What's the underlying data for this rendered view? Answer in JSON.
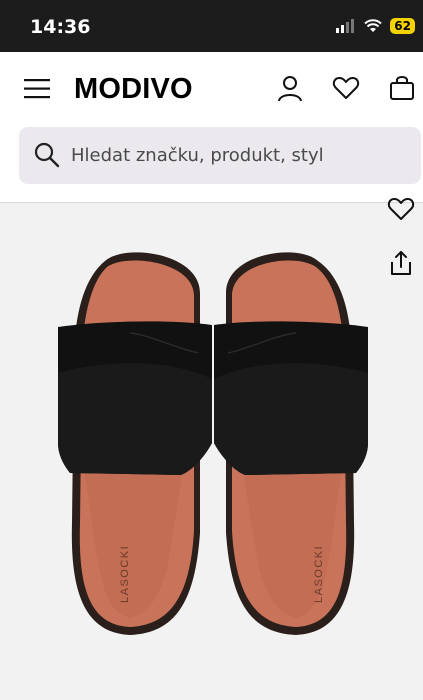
{
  "status": {
    "time": "14:36",
    "battery": "62"
  },
  "brand": {
    "logo": "MODIVO"
  },
  "search": {
    "placeholder": "Hledat značku, produkt, styl"
  },
  "product": {
    "brand_imprint": "LASOCKI"
  },
  "colors": {
    "status_bar": "#1c1c1c",
    "search_bg": "#ebe9ee",
    "battery": "#f5d300",
    "sole": "#c9745a",
    "strap": "#111111"
  },
  "icons": [
    "menu-icon",
    "user-icon",
    "heart-icon",
    "bag-icon",
    "search-icon",
    "share-icon"
  ]
}
